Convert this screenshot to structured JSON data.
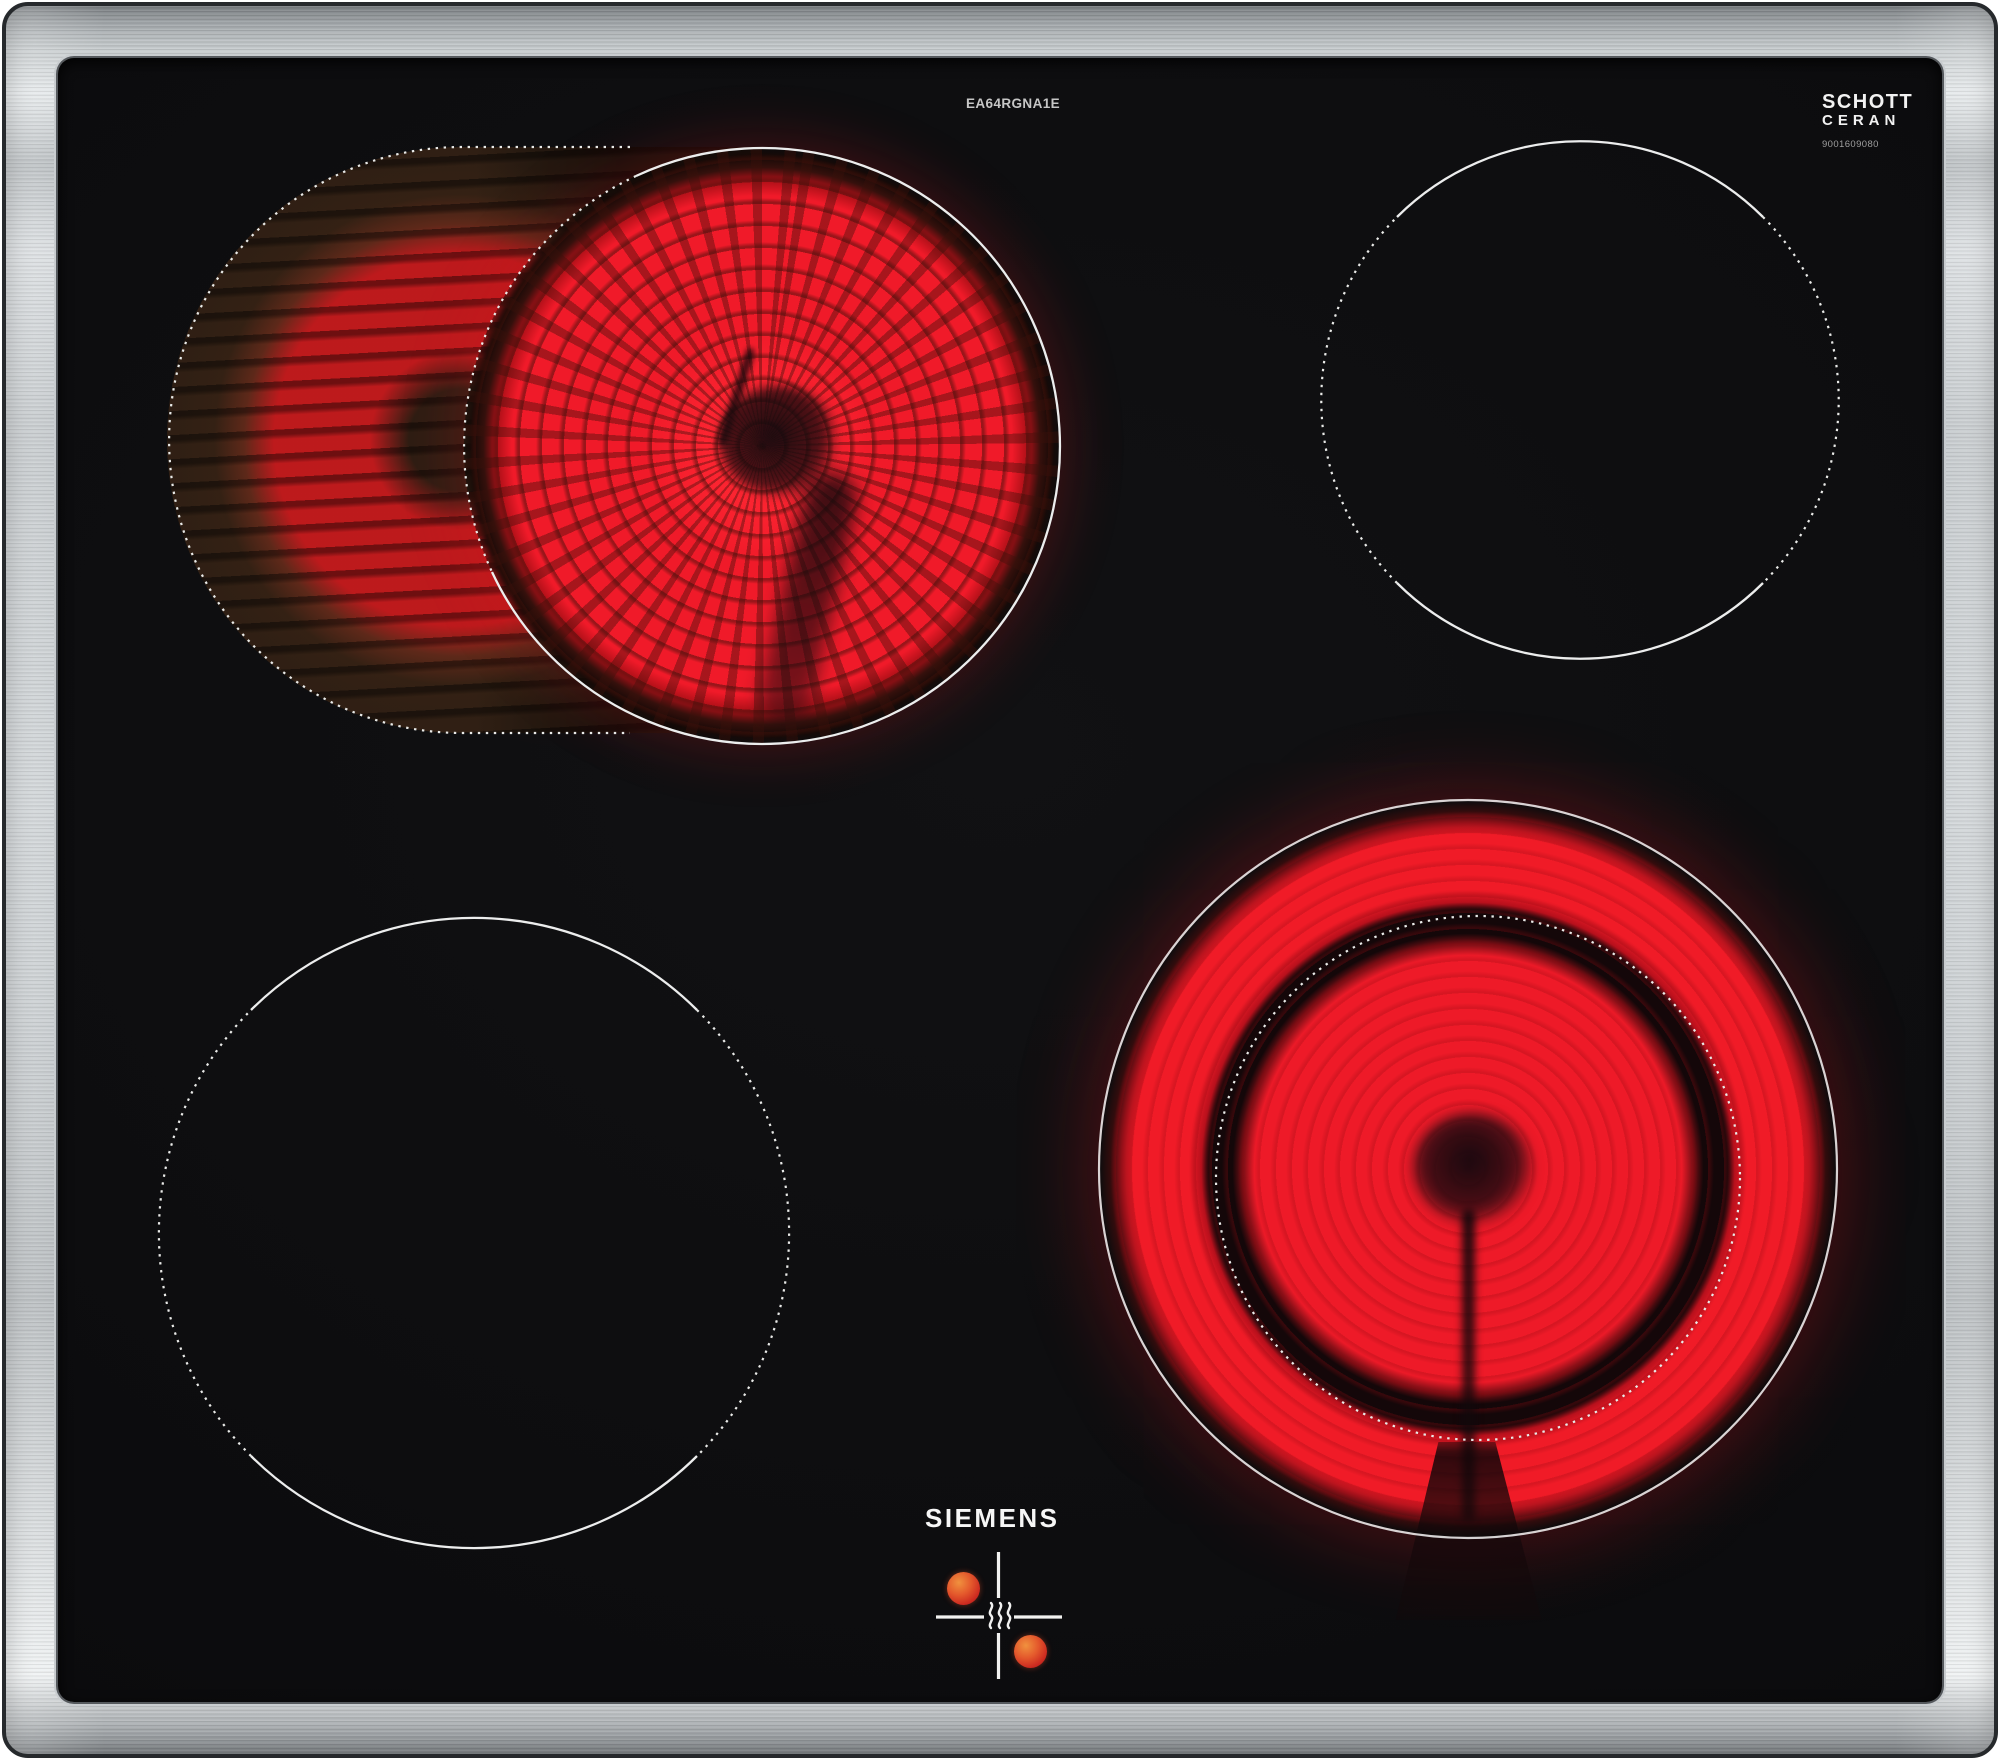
{
  "device": {
    "brand_logo": "SIEMENS",
    "model_number": "EA64RGNA1E"
  },
  "glass_branding": {
    "maker": "SCHOTT",
    "product": "CERAN",
    "code": "9001609080"
  },
  "zones": {
    "rear_left": {
      "name": "dual roaster zone",
      "state": "on",
      "glowing": true
    },
    "rear_right": {
      "name": "single zone",
      "state": "off",
      "glowing": false
    },
    "front_left": {
      "name": "single zone",
      "state": "off",
      "glowing": false
    },
    "front_right": {
      "name": "dual ring zone",
      "state": "on",
      "glowing": true
    }
  },
  "residual_heat_indicator": {
    "symbol": "heat-waves-cross",
    "hot_rear_left": true,
    "hot_front_right": true
  },
  "colors": {
    "glass": "#0c0c0e",
    "frame_light": "#e4e8ea",
    "frame_dark": "#878c90",
    "glow_bright_red": "#f01a29",
    "glow_dim_red": "#d6191e",
    "outline_white": "#eceded",
    "indicator_orange": "#e4592c"
  }
}
